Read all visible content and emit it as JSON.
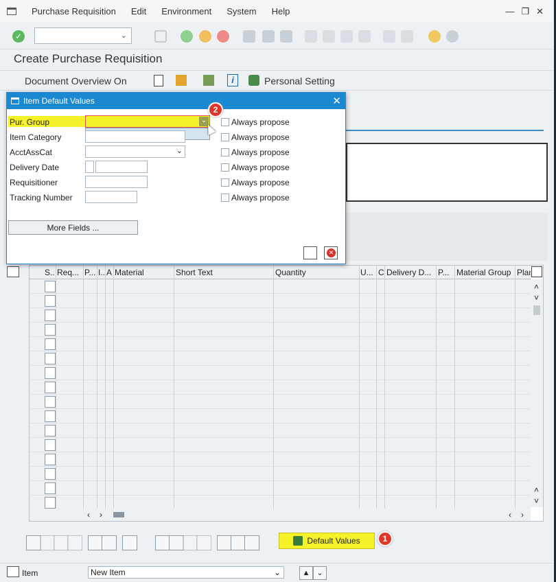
{
  "menu": [
    "Purchase Requisition",
    "Edit",
    "Environment",
    "System",
    "Help"
  ],
  "window_controls": [
    "—",
    "❐",
    "✕"
  ],
  "command_field": {
    "value": ""
  },
  "page_title": "Create Purchase Requisition",
  "app_toolbar": {
    "doc_overview": "Document Overview On",
    "personal_setting": "Personal Setting"
  },
  "grid": {
    "columns": [
      "S..",
      "Req...",
      "P...",
      "I..",
      "A",
      "Material",
      "Short Text",
      "Quantity",
      "U...",
      "C",
      "Delivery D...",
      "P...",
      "Material Group",
      "Plan"
    ],
    "row_count": 16
  },
  "default_values_button": "Default Values",
  "badges": {
    "one": "1",
    "two": "2"
  },
  "item_bar": {
    "label": "Item",
    "selection": "New Item"
  },
  "dialog": {
    "title": "Item Default Values",
    "fields": [
      {
        "label": "Pur. Group",
        "value": "",
        "always_propose": "Always propose"
      },
      {
        "label": "Item Category",
        "value": "",
        "always_propose": "Always propose"
      },
      {
        "label": "AcctAssCat",
        "value": "",
        "always_propose": "Always propose"
      },
      {
        "label": "Delivery Date",
        "value": "",
        "always_propose": "Always propose"
      },
      {
        "label": "Requisitioner",
        "value": "",
        "always_propose": "Always propose"
      },
      {
        "label": "Tracking Number",
        "value": "",
        "always_propose": "Always propose"
      }
    ],
    "more_fields": "More Fields ..."
  },
  "colors": {
    "dialog_title": "#1a89d1",
    "highlight": "#f5f22a",
    "badge": "#e0352b"
  }
}
